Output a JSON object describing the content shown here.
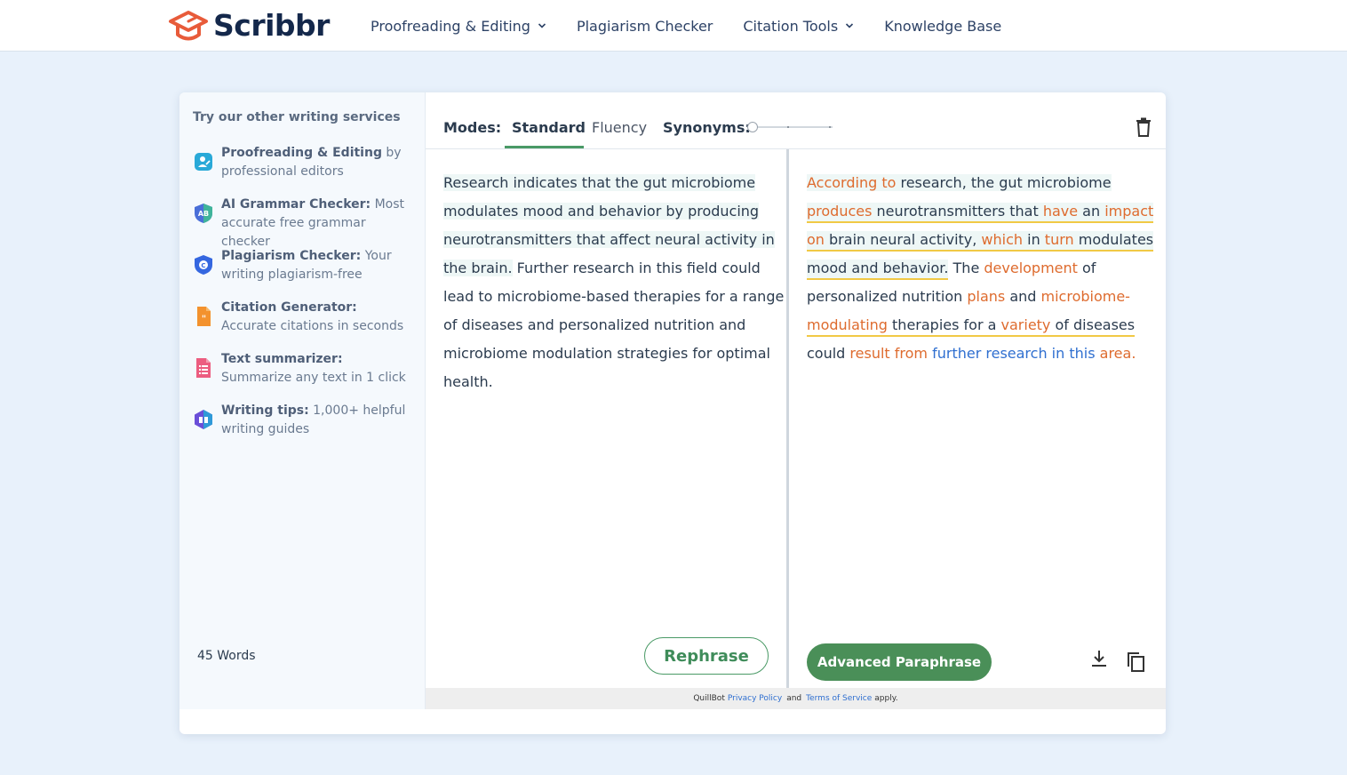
{
  "header": {
    "logo_text": "Scribbr",
    "nav": [
      {
        "label": "Proofreading & Editing",
        "has_dropdown": true
      },
      {
        "label": "Plagiarism Checker",
        "has_dropdown": false
      },
      {
        "label": "Citation Tools",
        "has_dropdown": true
      },
      {
        "label": "Knowledge Base",
        "has_dropdown": false
      }
    ]
  },
  "sidebar": {
    "title": "Try our other writing services",
    "services": [
      {
        "name": "Proofreading & Editing",
        "desc": " by professional editors",
        "icon": "editor-icon",
        "color": "#29a9d8"
      },
      {
        "name": "AI Grammar Checker:",
        "desc": " Most accurate free grammar checker",
        "icon": "grammar-icon",
        "color": "#4a6fd8"
      },
      {
        "name": "Plagiarism Checker:",
        "desc": " Your writing plagiarism-free",
        "icon": "plagiarism-icon",
        "color": "#3567e0"
      },
      {
        "name": "Citation Generator:",
        "desc": " Accurate citations in seconds",
        "icon": "citation-icon",
        "color": "#f3922e"
      },
      {
        "name": "Text summarizer:",
        "desc": " Summarize any text in 1 click",
        "icon": "summarizer-icon",
        "color": "#ec5d80"
      },
      {
        "name": "Writing tips:",
        "desc": " 1,000+ helpful writing guides",
        "icon": "writing-tips-icon",
        "color": "#6b4fd8"
      }
    ]
  },
  "toolbar": {
    "modes_label": "Modes:",
    "tabs": [
      {
        "label": "Standard",
        "active": true
      },
      {
        "label": "Fluency",
        "active": false
      }
    ],
    "synonyms_label": "Synonyms:",
    "synonyms_level": 0
  },
  "input": {
    "lines": [
      "Research indicates that the gut microbiome",
      "modulates mood and behavior by producing",
      "neurotransmitters that affect neural activity in",
      "the brain.",
      " Further research in this field could",
      "lead to microbiome-based therapies for a range",
      "of diseases and personalized nutrition and",
      "microbiome modulation strategies for optimal",
      "health."
    ],
    "word_count": "45 Words",
    "rephrase_label": "Rephrase"
  },
  "output": {
    "segments": {
      "s1": "According to",
      "s2": " research, the gut microbiome",
      "s3": "produces",
      "s4": " neurotransmitters that ",
      "s5": "have",
      "s6": " an ",
      "s7": "impact",
      "s8": "on",
      "s9": " brain neural activity, ",
      "s10": "which",
      "s11": " in ",
      "s12": "turn",
      "s13": " modulates",
      "s14": "mood and behavior.",
      "s15": " The ",
      "s16": "development",
      "s17": " of",
      "s18": "personalized nutrition ",
      "s19": "plans",
      "s20": " and ",
      "s21": "microbiome-",
      "s22": "modulating",
      "s23": " therapies for a ",
      "s24": "variety",
      "s25": " of diseases",
      "s26": "could ",
      "s27": "result from",
      "s28": " further research in this ",
      "s29": "area."
    },
    "advanced_label": "Advanced Paraphrase"
  },
  "legal": {
    "prefix": "QuillBot",
    "privacy": "Privacy Policy",
    "and": "and",
    "terms": "Terms of Service",
    "suffix": "apply."
  },
  "colors": {
    "accent_green": "#4a8f58",
    "changed_word": "#de6b2e",
    "structural_change": "#2f6fd0",
    "underline": "#f1c945"
  }
}
